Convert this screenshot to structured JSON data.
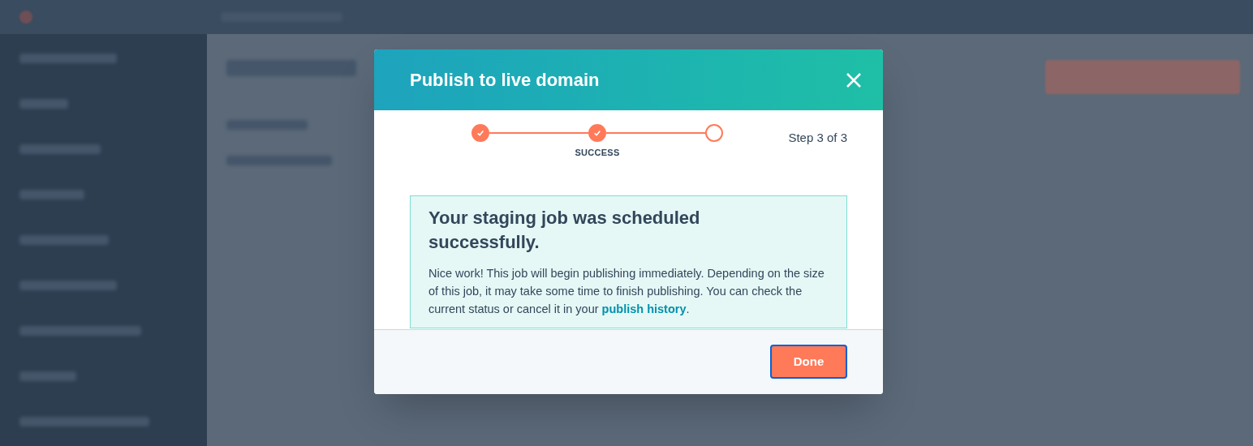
{
  "dialog": {
    "title": "Publish to live domain",
    "steps": [
      {
        "done": true
      },
      {
        "done": true,
        "label": "SUCCESS"
      },
      {
        "done": false
      }
    ],
    "step_counter": "Step 3 of 3",
    "message": {
      "heading": "Your staging job was scheduled successfully.",
      "body": "Nice work! This job will begin publishing immediately. Depending on the size of this job, it may take some time to finish publishing. You can check the current status or cancel it in your ",
      "link": "publish history",
      "after_link": "."
    },
    "buttons": [
      {
        "label": "Done",
        "focused": true
      }
    ]
  }
}
